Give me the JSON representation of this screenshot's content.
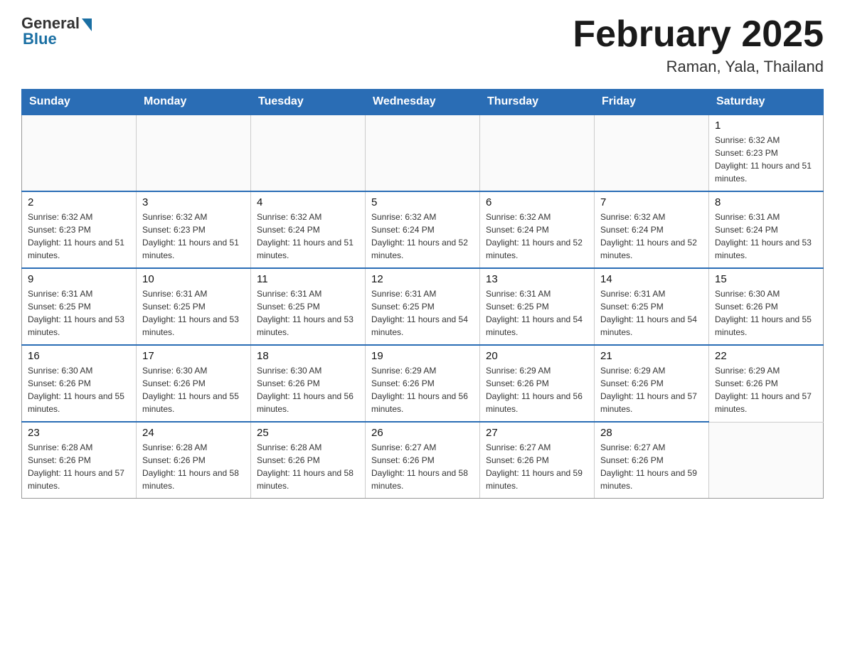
{
  "header": {
    "logo_general": "General",
    "logo_blue": "Blue",
    "month_title": "February 2025",
    "location": "Raman, Yala, Thailand"
  },
  "days_of_week": [
    "Sunday",
    "Monday",
    "Tuesday",
    "Wednesday",
    "Thursday",
    "Friday",
    "Saturday"
  ],
  "weeks": [
    [
      {
        "day": "",
        "info": ""
      },
      {
        "day": "",
        "info": ""
      },
      {
        "day": "",
        "info": ""
      },
      {
        "day": "",
        "info": ""
      },
      {
        "day": "",
        "info": ""
      },
      {
        "day": "",
        "info": ""
      },
      {
        "day": "1",
        "info": "Sunrise: 6:32 AM\nSunset: 6:23 PM\nDaylight: 11 hours and 51 minutes."
      }
    ],
    [
      {
        "day": "2",
        "info": "Sunrise: 6:32 AM\nSunset: 6:23 PM\nDaylight: 11 hours and 51 minutes."
      },
      {
        "day": "3",
        "info": "Sunrise: 6:32 AM\nSunset: 6:23 PM\nDaylight: 11 hours and 51 minutes."
      },
      {
        "day": "4",
        "info": "Sunrise: 6:32 AM\nSunset: 6:24 PM\nDaylight: 11 hours and 51 minutes."
      },
      {
        "day": "5",
        "info": "Sunrise: 6:32 AM\nSunset: 6:24 PM\nDaylight: 11 hours and 52 minutes."
      },
      {
        "day": "6",
        "info": "Sunrise: 6:32 AM\nSunset: 6:24 PM\nDaylight: 11 hours and 52 minutes."
      },
      {
        "day": "7",
        "info": "Sunrise: 6:32 AM\nSunset: 6:24 PM\nDaylight: 11 hours and 52 minutes."
      },
      {
        "day": "8",
        "info": "Sunrise: 6:31 AM\nSunset: 6:24 PM\nDaylight: 11 hours and 53 minutes."
      }
    ],
    [
      {
        "day": "9",
        "info": "Sunrise: 6:31 AM\nSunset: 6:25 PM\nDaylight: 11 hours and 53 minutes."
      },
      {
        "day": "10",
        "info": "Sunrise: 6:31 AM\nSunset: 6:25 PM\nDaylight: 11 hours and 53 minutes."
      },
      {
        "day": "11",
        "info": "Sunrise: 6:31 AM\nSunset: 6:25 PM\nDaylight: 11 hours and 53 minutes."
      },
      {
        "day": "12",
        "info": "Sunrise: 6:31 AM\nSunset: 6:25 PM\nDaylight: 11 hours and 54 minutes."
      },
      {
        "day": "13",
        "info": "Sunrise: 6:31 AM\nSunset: 6:25 PM\nDaylight: 11 hours and 54 minutes."
      },
      {
        "day": "14",
        "info": "Sunrise: 6:31 AM\nSunset: 6:25 PM\nDaylight: 11 hours and 54 minutes."
      },
      {
        "day": "15",
        "info": "Sunrise: 6:30 AM\nSunset: 6:26 PM\nDaylight: 11 hours and 55 minutes."
      }
    ],
    [
      {
        "day": "16",
        "info": "Sunrise: 6:30 AM\nSunset: 6:26 PM\nDaylight: 11 hours and 55 minutes."
      },
      {
        "day": "17",
        "info": "Sunrise: 6:30 AM\nSunset: 6:26 PM\nDaylight: 11 hours and 55 minutes."
      },
      {
        "day": "18",
        "info": "Sunrise: 6:30 AM\nSunset: 6:26 PM\nDaylight: 11 hours and 56 minutes."
      },
      {
        "day": "19",
        "info": "Sunrise: 6:29 AM\nSunset: 6:26 PM\nDaylight: 11 hours and 56 minutes."
      },
      {
        "day": "20",
        "info": "Sunrise: 6:29 AM\nSunset: 6:26 PM\nDaylight: 11 hours and 56 minutes."
      },
      {
        "day": "21",
        "info": "Sunrise: 6:29 AM\nSunset: 6:26 PM\nDaylight: 11 hours and 57 minutes."
      },
      {
        "day": "22",
        "info": "Sunrise: 6:29 AM\nSunset: 6:26 PM\nDaylight: 11 hours and 57 minutes."
      }
    ],
    [
      {
        "day": "23",
        "info": "Sunrise: 6:28 AM\nSunset: 6:26 PM\nDaylight: 11 hours and 57 minutes."
      },
      {
        "day": "24",
        "info": "Sunrise: 6:28 AM\nSunset: 6:26 PM\nDaylight: 11 hours and 58 minutes."
      },
      {
        "day": "25",
        "info": "Sunrise: 6:28 AM\nSunset: 6:26 PM\nDaylight: 11 hours and 58 minutes."
      },
      {
        "day": "26",
        "info": "Sunrise: 6:27 AM\nSunset: 6:26 PM\nDaylight: 11 hours and 58 minutes."
      },
      {
        "day": "27",
        "info": "Sunrise: 6:27 AM\nSunset: 6:26 PM\nDaylight: 11 hours and 59 minutes."
      },
      {
        "day": "28",
        "info": "Sunrise: 6:27 AM\nSunset: 6:26 PM\nDaylight: 11 hours and 59 minutes."
      },
      {
        "day": "",
        "info": ""
      }
    ]
  ]
}
